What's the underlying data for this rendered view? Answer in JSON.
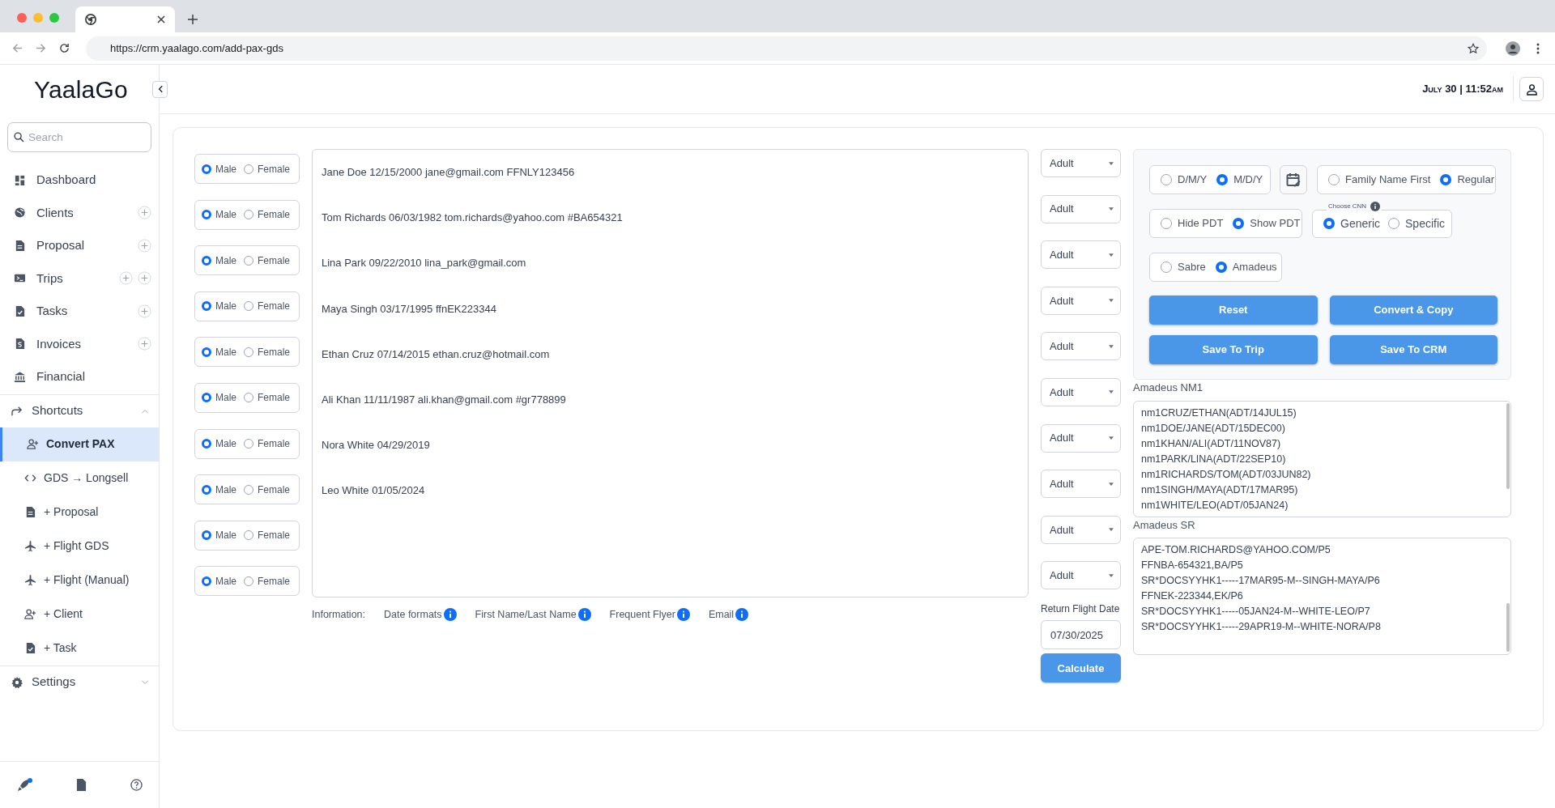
{
  "browser": {
    "url": "https://crm.yaalago.com/add-pax-gds"
  },
  "header": {
    "logo": "YaalaGo",
    "datetime": "July 30 | 11:52am"
  },
  "sidebar": {
    "search": {
      "placeholder": "Search"
    },
    "items": [
      {
        "label": "Dashboard",
        "kind": "plain"
      },
      {
        "label": "Clients",
        "kind": "add"
      },
      {
        "label": "Proposal",
        "kind": "add"
      },
      {
        "label": "Trips",
        "kind": "double-add"
      },
      {
        "label": "Tasks",
        "kind": "add"
      },
      {
        "label": "Invoices",
        "kind": "add"
      },
      {
        "label": "Financial",
        "kind": "plain"
      }
    ],
    "shortcuts": {
      "label": "Shortcuts",
      "expanded": true,
      "children": [
        {
          "label": "Convert PAX",
          "selected": true
        },
        {
          "label": "GDS → Longsell",
          "selected": false
        },
        {
          "label": "+ Proposal",
          "selected": false
        },
        {
          "label": "+ Flight GDS",
          "selected": false
        },
        {
          "label": "+ Flight (Manual)",
          "selected": false
        },
        {
          "label": "+ Client",
          "selected": false
        },
        {
          "label": "+ Task",
          "selected": false
        }
      ]
    },
    "settings": {
      "label": "Settings",
      "expanded": false
    }
  },
  "passengers": [
    {
      "gender": [
        {
          "label": "Male",
          "selected": true
        },
        {
          "label": "Female",
          "selected": false
        }
      ],
      "type": "Adult"
    },
    {
      "gender": [
        {
          "label": "Male",
          "selected": true
        },
        {
          "label": "Female",
          "selected": false
        }
      ],
      "type": "Adult"
    },
    {
      "gender": [
        {
          "label": "Male",
          "selected": true
        },
        {
          "label": "Female",
          "selected": false
        }
      ],
      "type": "Adult"
    },
    {
      "gender": [
        {
          "label": "Male",
          "selected": true
        },
        {
          "label": "Female",
          "selected": false
        }
      ],
      "type": "Adult"
    },
    {
      "gender": [
        {
          "label": "Male",
          "selected": true
        },
        {
          "label": "Female",
          "selected": false
        }
      ],
      "type": "Adult"
    },
    {
      "gender": [
        {
          "label": "Male",
          "selected": true
        },
        {
          "label": "Female",
          "selected": false
        }
      ],
      "type": "Adult"
    },
    {
      "gender": [
        {
          "label": "Male",
          "selected": true
        },
        {
          "label": "Female",
          "selected": false
        }
      ],
      "type": "Adult"
    },
    {
      "gender": [
        {
          "label": "Male",
          "selected": true
        },
        {
          "label": "Female",
          "selected": false
        }
      ],
      "type": "Adult"
    },
    {
      "gender": [
        {
          "label": "Male",
          "selected": true
        },
        {
          "label": "Female",
          "selected": false
        }
      ],
      "type": "Adult"
    },
    {
      "gender": [
        {
          "label": "Male",
          "selected": true
        },
        {
          "label": "Female",
          "selected": false
        }
      ],
      "type": "Adult"
    }
  ],
  "passenger_text": [
    "Jane Doe 12/15/2000 jane@gmail.com FFNLY123456",
    "Tom Richards 06/03/1982 tom.richards@yahoo.com #BA654321",
    "Lina Park 09/22/2010 lina_park@gmail.com",
    "Maya Singh 03/17/1995 ffnEK223344",
    "Ethan Cruz 07/14/2015 ethan.cruz@hotmail.com",
    "Ali Khan 11/11/1987 ali.khan@gmail.com #gr778899",
    "Nora White 04/29/2019",
    "Leo White 01/05/2024"
  ],
  "information": {
    "label": "Information:",
    "items": [
      "Date formats",
      "First Name/Last Name",
      "Frequent Flyer",
      "Email"
    ]
  },
  "return_flight": {
    "label": "Return Flight Date",
    "value": "07/30/2025",
    "button": "Calculate"
  },
  "options": {
    "date_format": [
      {
        "label": "D/M/Y",
        "selected": false
      },
      {
        "label": "M/D/Y",
        "selected": true
      }
    ],
    "name_order": [
      {
        "label": "Family Name First",
        "selected": false
      },
      {
        "label": "Regular",
        "selected": true
      }
    ],
    "pdt": [
      {
        "label": "Hide PDT",
        "selected": false
      },
      {
        "label": "Show PDT",
        "selected": true
      }
    ],
    "cnn": {
      "legend": "Choose CNN",
      "options": [
        {
          "label": "Generic",
          "selected": true
        },
        {
          "label": "Specific",
          "selected": false
        }
      ]
    },
    "gds": [
      {
        "label": "Sabre",
        "selected": false
      },
      {
        "label": "Amadeus",
        "selected": true
      }
    ]
  },
  "buttons": [
    "Reset",
    "Convert & Copy",
    "Save To Trip",
    "Save To CRM"
  ],
  "nm1": {
    "label": "Amadeus NM1",
    "lines": [
      "nm1CRUZ/ETHAN(ADT/14JUL15)",
      "nm1DOE/JANE(ADT/15DEC00)",
      "nm1KHAN/ALI(ADT/11NOV87)",
      "nm1PARK/LINA(ADT/22SEP10)",
      "nm1RICHARDS/TOM(ADT/03JUN82)",
      "nm1SINGH/MAYA(ADT/17MAR95)",
      "nm1WHITE/LEO(ADT/05JAN24)"
    ]
  },
  "sr": {
    "label": "Amadeus SR",
    "lines": [
      "APE-TOM.RICHARDS@YAHOO.COM/P5",
      "FFNBA-654321,BA/P5",
      "SR*DOCSYYHK1-----17MAR95-M--SINGH-MAYA/P6",
      "FFNEK-223344,EK/P6",
      "SR*DOCSYYHK1-----05JAN24-M--WHITE-LEO/P7",
      "SR*DOCSYYHK1-----29APR19-M--WHITE-NORA/P8"
    ]
  }
}
